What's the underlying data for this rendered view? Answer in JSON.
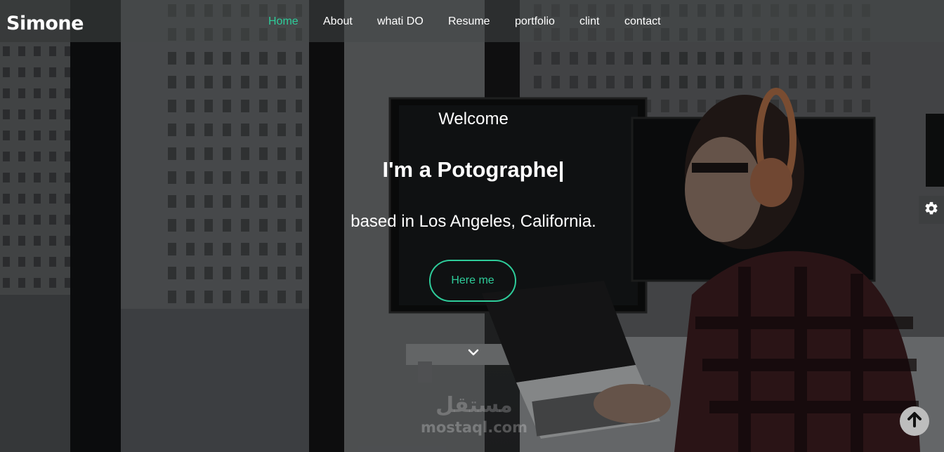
{
  "brand": "Simone",
  "nav": {
    "items": [
      {
        "label": "Home",
        "active": true
      },
      {
        "label": "About",
        "active": false
      },
      {
        "label": "whati DO",
        "active": false
      },
      {
        "label": "Resume",
        "active": false
      },
      {
        "label": "portfolio",
        "active": false
      },
      {
        "label": "clint",
        "active": false
      },
      {
        "label": "contact",
        "active": false
      }
    ]
  },
  "hero": {
    "welcome": "Welcome",
    "headline": "I'm a Potographe",
    "caret": "|",
    "subline": "based in Los Angeles, California.",
    "cta_label": "Here me"
  },
  "watermark": {
    "arabic": "مستقل",
    "latin": "mostaql.com"
  },
  "icons": {
    "scroll": "chevron-down-icon",
    "settings": "gear-icon",
    "to_top": "arrow-up-icon"
  },
  "colors": {
    "accent": "#2ecc9a",
    "text": "#ffffff",
    "navbar_bg": "#464849"
  }
}
